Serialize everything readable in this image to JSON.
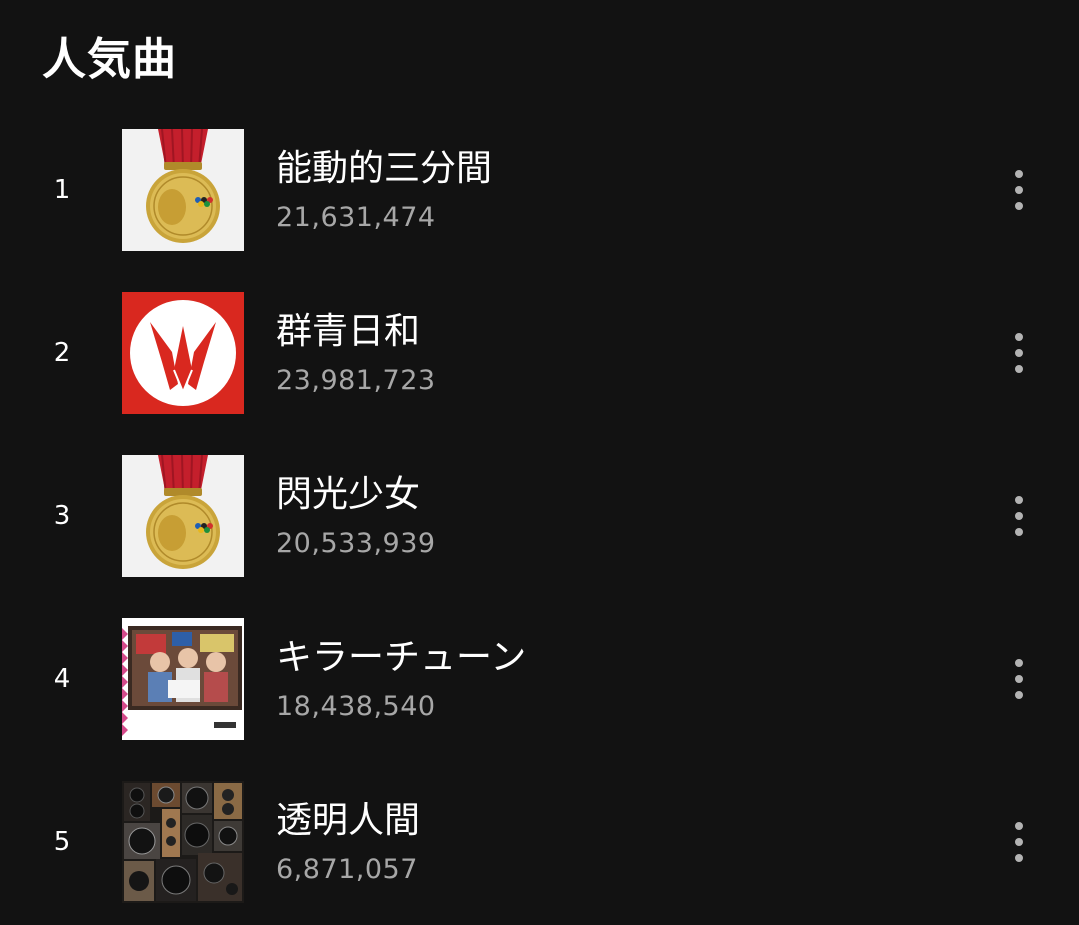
{
  "section": {
    "title": "人気曲"
  },
  "tracks": [
    {
      "rank": "1",
      "title": "能動的三分間",
      "plays": "21,631,474",
      "art": "medal-art"
    },
    {
      "rank": "2",
      "title": "群青日和",
      "plays": "23,981,723",
      "art": "crane-logo-art"
    },
    {
      "rank": "3",
      "title": "閃光少女",
      "plays": "20,533,939",
      "art": "medal-art"
    },
    {
      "rank": "4",
      "title": "キラーチューン",
      "plays": "18,438,540",
      "art": "band-photo-art"
    },
    {
      "rank": "5",
      "title": "透明人間",
      "plays": "6,871,057",
      "art": "speakers-art"
    }
  ],
  "icons": {
    "more": "more-vertical-icon"
  },
  "colors": {
    "background": "#121212",
    "text_primary": "#ffffff",
    "text_secondary": "#a7a7a7",
    "crane_red": "#d9281f"
  }
}
